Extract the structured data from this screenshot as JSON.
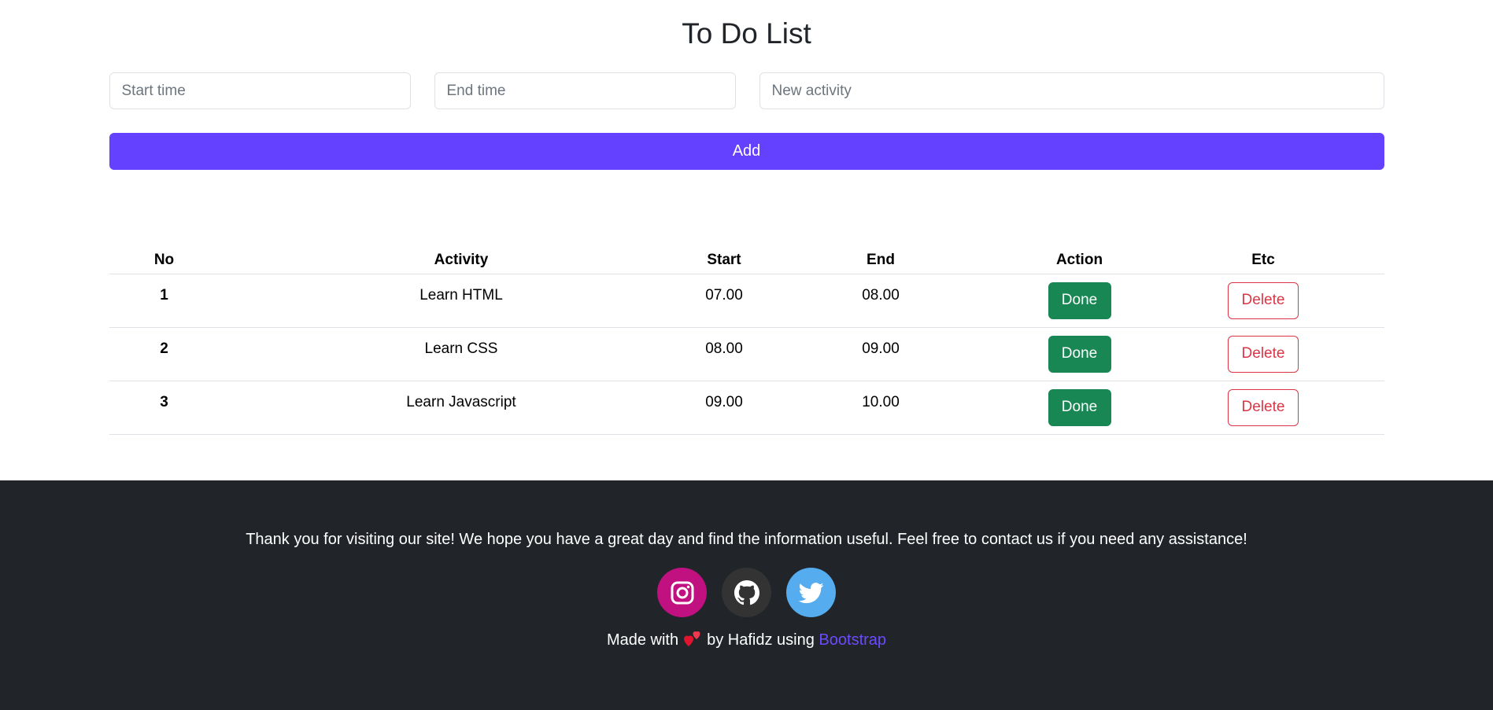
{
  "page": {
    "title": "To Do List"
  },
  "form": {
    "start_placeholder": "Start time",
    "end_placeholder": "End time",
    "activity_placeholder": "New activity",
    "add_label": "Add"
  },
  "table": {
    "headers": [
      "No",
      "Activity",
      "Start",
      "End",
      "Action",
      "Etc"
    ],
    "rows": [
      {
        "no": "1",
        "activity": "Learn HTML",
        "start": "07.00",
        "end": "08.00",
        "action": "Done",
        "etc": "Delete"
      },
      {
        "no": "2",
        "activity": "Learn CSS",
        "start": "08.00",
        "end": "09.00",
        "action": "Done",
        "etc": "Delete"
      },
      {
        "no": "3",
        "activity": "Learn Javascript",
        "start": "09.00",
        "end": "10.00",
        "action": "Done",
        "etc": "Delete"
      }
    ]
  },
  "footer": {
    "message": "Thank you for visiting our site! We hope you have a great day and find the information useful. Feel free to contact us if you need any assistance!",
    "socials": [
      {
        "name": "instagram-icon",
        "color": "#c1107f"
      },
      {
        "name": "github-icon",
        "color": "#333333"
      },
      {
        "name": "twitter-icon",
        "color": "#55acee"
      }
    ],
    "made_prefix": "Made with",
    "made_by": "by Hafidz using",
    "link_text": "Bootstrap"
  },
  "colors": {
    "primary": "#6441ff",
    "success": "#198754",
    "danger": "#dc3545",
    "footer_bg": "#212529"
  }
}
